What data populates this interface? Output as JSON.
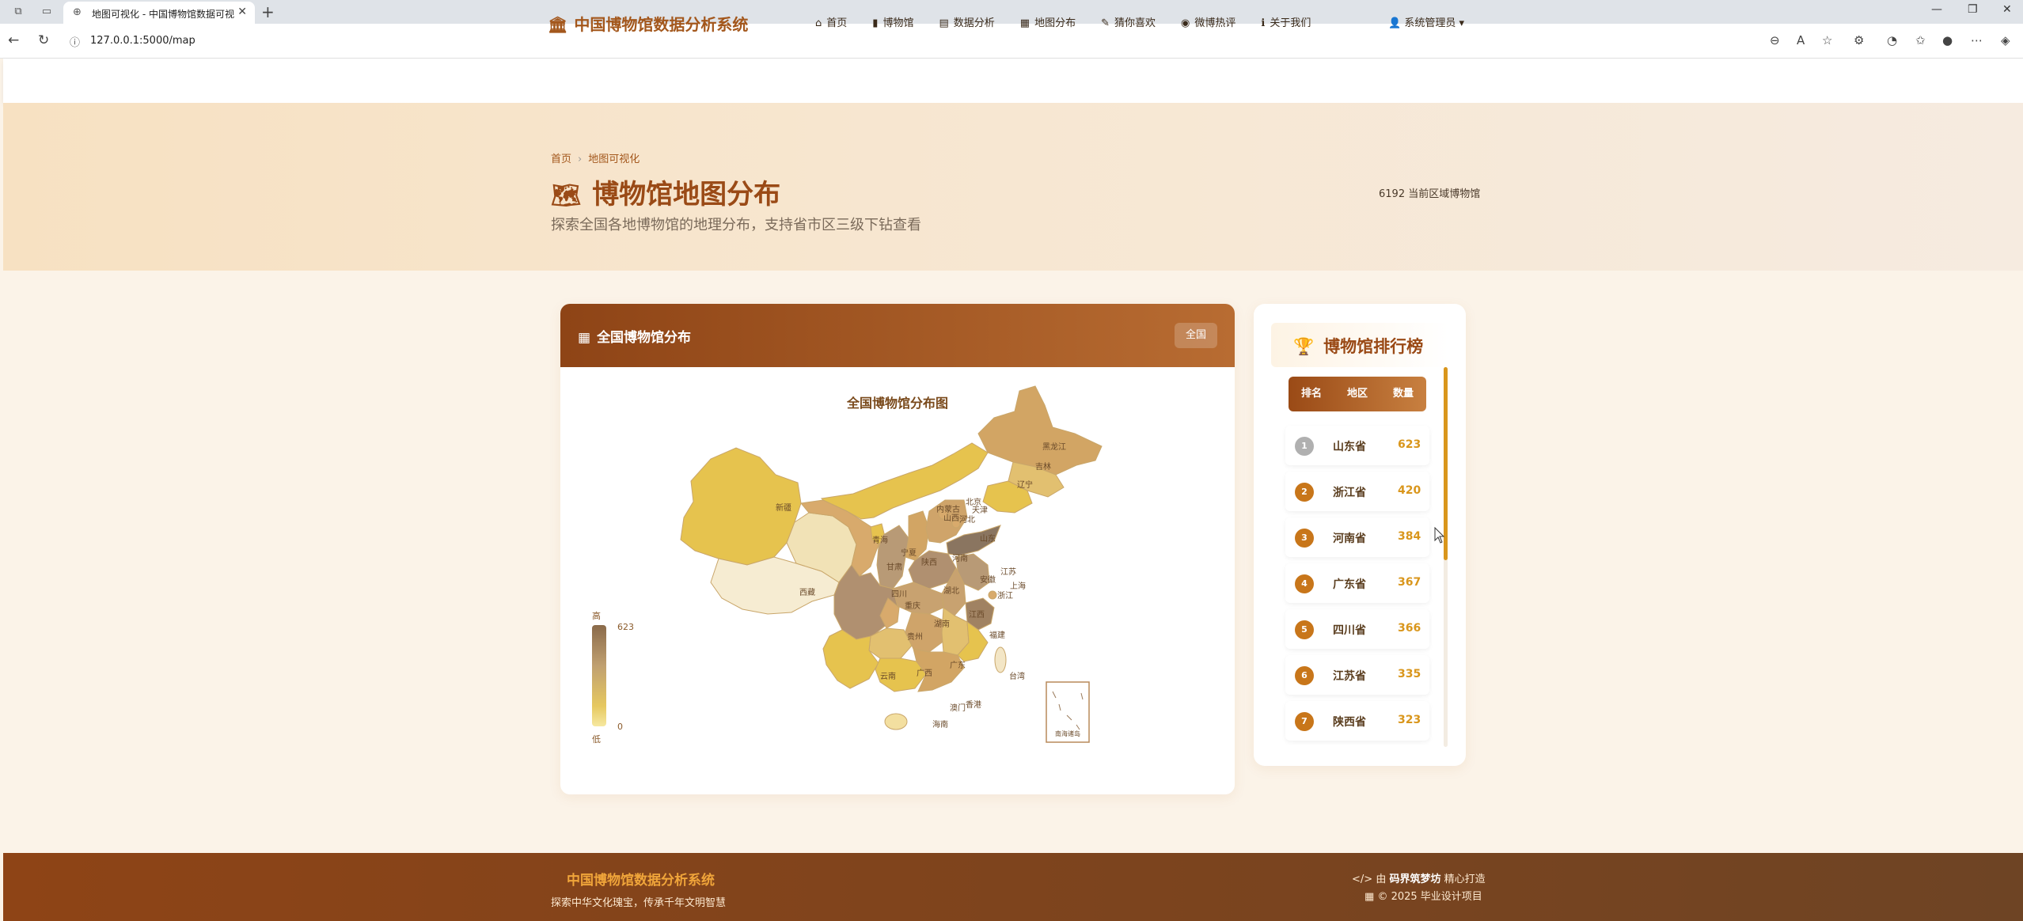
{
  "browser": {
    "tab_title": "地图可视化 - 中国博物馆数据可视化",
    "url": "127.0.0.1:5000/map"
  },
  "site": {
    "brand": "中国博物馆数据分析系统",
    "user": "系统管理员",
    "menu": [
      {
        "label": "首页",
        "icon": "home-icon"
      },
      {
        "label": "博物馆",
        "icon": "bookmark-icon"
      },
      {
        "label": "数据分析",
        "icon": "chart-icon"
      },
      {
        "label": "地图分布",
        "icon": "map-icon"
      },
      {
        "label": "猜你喜欢",
        "icon": "pencil-icon"
      },
      {
        "label": "微博热评",
        "icon": "weibo-icon"
      },
      {
        "label": "关于我们",
        "icon": "info-icon"
      }
    ]
  },
  "hero": {
    "breadcrumb": [
      "首页",
      "地图可视化"
    ],
    "title": "博物馆地图分布",
    "subtitle": "探索全国各地博物馆的地理分布，支持省市区三级下钻查看",
    "stat": "6192 当前区域博物馆"
  },
  "map_card": {
    "header": "全国博物馆分布",
    "region_button": "全国",
    "map_title": "全国博物馆分布图",
    "legend": {
      "high_label": "高",
      "low_label": "低",
      "max": "623",
      "min": "0"
    },
    "labels": [
      "新疆",
      "西藏",
      "青海",
      "甘肃",
      "宁夏",
      "内蒙古",
      "黑龙江",
      "吉林",
      "辽宁",
      "北京",
      "天津",
      "河北",
      "山西",
      "山东",
      "陕西",
      "河南",
      "四川",
      "重庆",
      "湖北",
      "安徽",
      "江苏",
      "上海",
      "浙江",
      "湖南",
      "江西",
      "福建",
      "贵州",
      "云南",
      "广西",
      "广东",
      "台湾",
      "海南",
      "香港",
      "澳门",
      "南海诸岛"
    ],
    "colors": {
      "darkest": "#8a6a4a",
      "mid": "#c0a070",
      "light": "#e6c860",
      "lightest": "#f6ecd2"
    }
  },
  "ranking": {
    "title": "博物馆排行榜",
    "columns": [
      "排名",
      "地区",
      "数量"
    ],
    "rows": [
      {
        "rank": "1",
        "region": "山东省",
        "count": "623"
      },
      {
        "rank": "2",
        "region": "浙江省",
        "count": "420"
      },
      {
        "rank": "3",
        "region": "河南省",
        "count": "384"
      },
      {
        "rank": "4",
        "region": "广东省",
        "count": "367"
      },
      {
        "rank": "5",
        "region": "四川省",
        "count": "366"
      },
      {
        "rank": "6",
        "region": "江苏省",
        "count": "335"
      },
      {
        "rank": "7",
        "region": "陕西省",
        "count": "323"
      }
    ]
  },
  "footer": {
    "brand": "中国博物馆数据分析系统",
    "tagline": "探索中华文化瑰宝，传承千年文明智慧",
    "made_prefix": "由",
    "made_author": "码界筑梦坊",
    "made_suffix": "精心打造",
    "copyright": "© 2025 毕业设计项目"
  }
}
